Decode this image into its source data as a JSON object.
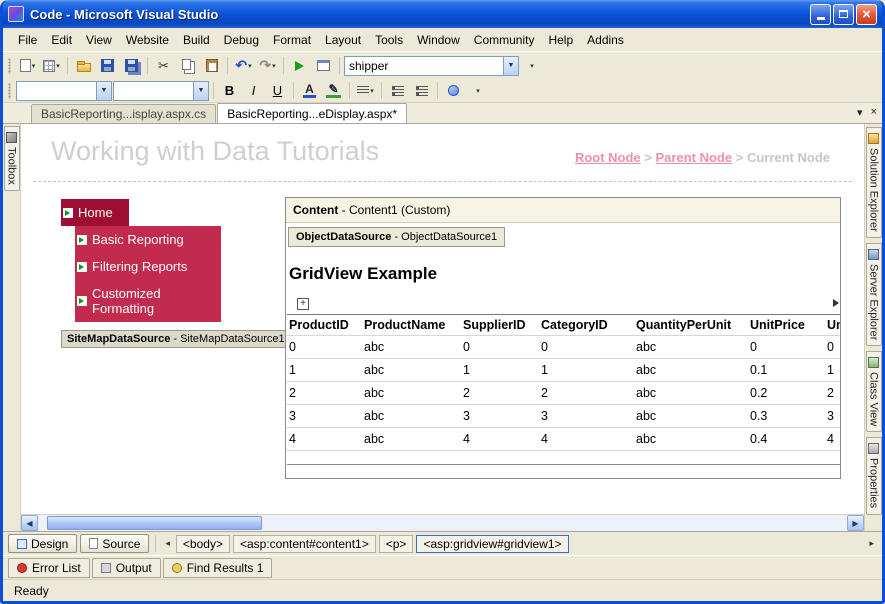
{
  "window": {
    "title": "Code - Microsoft Visual Studio"
  },
  "menubar": {
    "items": [
      "File",
      "Edit",
      "View",
      "Website",
      "Build",
      "Debug",
      "Format",
      "Layout",
      "Tools",
      "Window",
      "Community",
      "Help",
      "Addins"
    ]
  },
  "toolbar": {
    "element_combo": "shipper"
  },
  "doc_tabs": {
    "inactive": "BasicReporting...isplay.aspx.cs",
    "active": "BasicReporting...eDisplay.aspx*"
  },
  "side_panels": {
    "left": "Toolbox",
    "right": [
      "Solution Explorer",
      "Server Explorer",
      "Class View",
      "Properties"
    ]
  },
  "design": {
    "page_title": "Working with Data Tutorials",
    "breadcrumb": {
      "root": "Root Node",
      "sep": ">",
      "parent": "Parent Node",
      "current": "Current Node"
    },
    "nav_items": [
      "Home",
      "Basic Reporting",
      "Filtering Reports",
      "Customized Formatting"
    ],
    "sitemap_bold": "SiteMapDataSource",
    "sitemap_rest": " - SiteMapDataSource1",
    "content_bold": "Content",
    "content_rest": " - Content1 (Custom)",
    "ods_bold": "ObjectDataSource",
    "ods_rest": " - ObjectDataSource1",
    "grid_title": "GridView Example",
    "grid_headers": [
      "ProductID",
      "ProductName",
      "SupplierID",
      "CategoryID",
      "QuantityPerUnit",
      "UnitPrice",
      "Uni"
    ],
    "grid_rows": [
      [
        "0",
        "abc",
        "0",
        "0",
        "abc",
        "0",
        "0"
      ],
      [
        "1",
        "abc",
        "1",
        "1",
        "abc",
        "0.1",
        "1"
      ],
      [
        "2",
        "abc",
        "2",
        "2",
        "abc",
        "0.2",
        "2"
      ],
      [
        "3",
        "abc",
        "3",
        "3",
        "abc",
        "0.3",
        "3"
      ],
      [
        "4",
        "abc",
        "4",
        "4",
        "abc",
        "0.4",
        "4"
      ]
    ]
  },
  "view_bar": {
    "design": "Design",
    "source": "Source",
    "tags": [
      "<body>",
      "<asp:content#content1>",
      "<p>",
      "<asp:gridview#gridview1>"
    ]
  },
  "panel_tabs": [
    "Error List",
    "Output",
    "Find Results 1"
  ],
  "status": {
    "text": "Ready"
  },
  "colors": {
    "nav_home": "#9E0E32",
    "nav_item": "#C22A4E",
    "link": "#EE8FAE",
    "title_text": "#CFCFCF"
  }
}
